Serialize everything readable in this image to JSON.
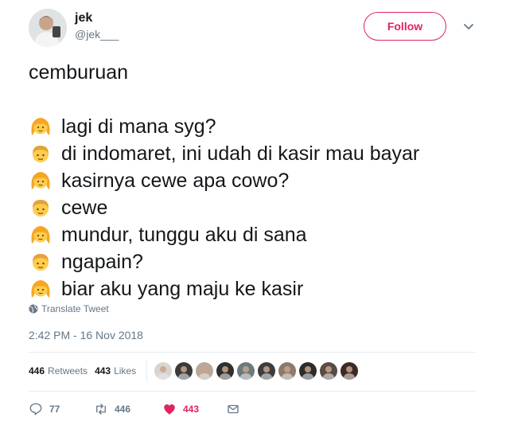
{
  "user": {
    "display_name": "jek",
    "screen_name": "@jek___"
  },
  "follow_label": "Follow",
  "tweet": {
    "title_line": "cemburuan",
    "lines": [
      {
        "speaker": "girl",
        "text": "lagi di mana syg?"
      },
      {
        "speaker": "boy",
        "text": "di indomaret, ini udah di kasir mau bayar"
      },
      {
        "speaker": "girl",
        "text": "kasirnya cewe apa cowo?"
      },
      {
        "speaker": "boy",
        "text": "cewe"
      },
      {
        "speaker": "girl",
        "text": "mundur, tunggu aku di sana"
      },
      {
        "speaker": "boy",
        "text": "ngapain?"
      },
      {
        "speaker": "girl",
        "text": "biar aku yang maju ke kasir"
      }
    ]
  },
  "translate_label": "Translate Tweet",
  "timestamp": "2:42 PM - 16 Nov 2018",
  "stats": {
    "retweets_count": "446",
    "retweets_label": "Retweets",
    "likes_count": "443",
    "likes_label": "Likes"
  },
  "likers": [
    "liker-1",
    "liker-2",
    "liker-3",
    "liker-4",
    "liker-5",
    "liker-6",
    "liker-7",
    "liker-8",
    "liker-9",
    "liker-10"
  ],
  "actions": {
    "replies": "77",
    "retweets": "446",
    "likes": "443"
  },
  "colors": {
    "accent": "#e0245e",
    "muted": "#657786",
    "text": "#14171a",
    "girl_hair": "#f5a623",
    "boy_hair": "#e2a33a",
    "emoji_face": "#ffcc4d"
  }
}
